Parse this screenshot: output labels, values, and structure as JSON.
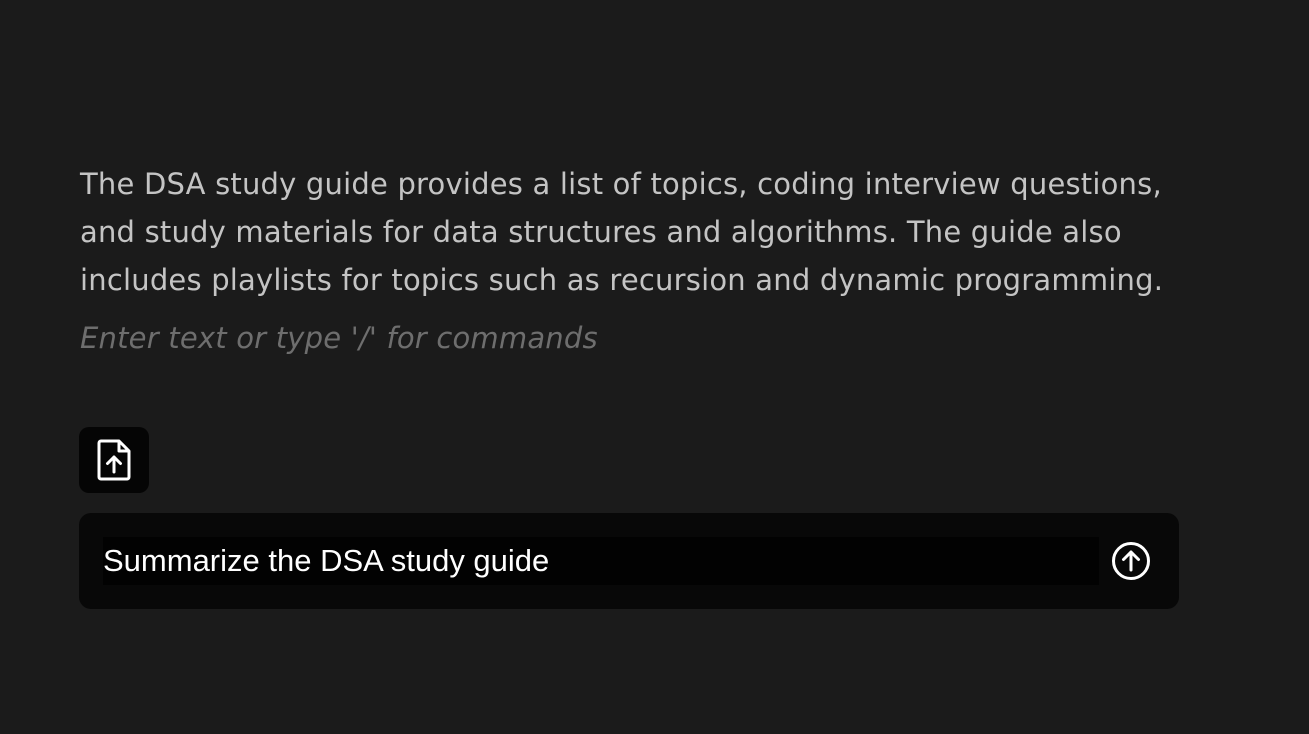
{
  "document": {
    "summary_text": "The DSA study guide provides a list of topics, coding interview questions, and study materials for data structures and algorithms. The guide also includes playlists for topics such as recursion and dynamic programming.",
    "placeholder": "Enter text or type '/' for commands"
  },
  "toolbar": {
    "upload_icon": "file-upload-icon"
  },
  "prompt": {
    "value": "Summarize the DSA study guide",
    "send_icon": "arrow-up-circle-icon"
  },
  "colors": {
    "background": "#1b1b1b",
    "body_text": "#c4c4c4",
    "placeholder_text": "#6e6e6e",
    "prompt_bar": "#080808",
    "button_bg": "#050505"
  }
}
